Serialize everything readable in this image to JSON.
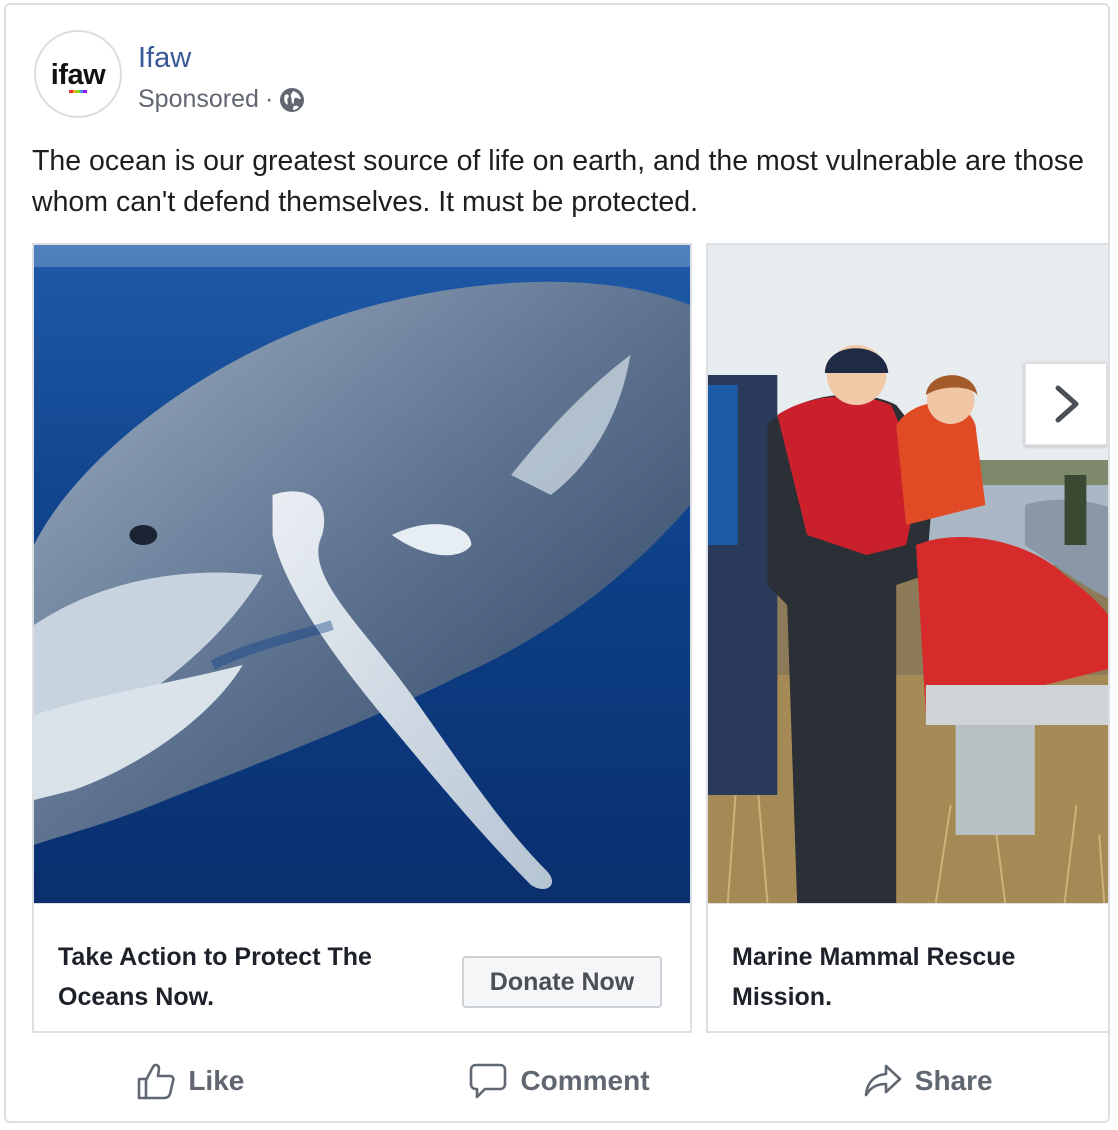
{
  "post": {
    "avatar_text": "ifaw",
    "page_name": "Ifaw",
    "sponsored_label": "Sponsored",
    "separator": "·",
    "message": "The ocean is our greatest source of life on earth, and the most vulnerable are those whom can't defend themselves. It must be protected."
  },
  "carousel": {
    "cards": [
      {
        "title": "Take Action to Protect The Oceans Now.",
        "cta": "Donate Now",
        "image": "humpback-whale-underwater"
      },
      {
        "title": "Marine Mammal Rescue Mission.",
        "image": "rescuers-with-stranded-dolphin"
      }
    ],
    "next_icon": "chevron-right-icon"
  },
  "actions": {
    "like": "Like",
    "comment": "Comment",
    "share": "Share"
  },
  "colors": {
    "page_name": "#385898",
    "secondary_text": "#606770",
    "border": "#dddfe2",
    "ocean": "#0d3f86"
  }
}
